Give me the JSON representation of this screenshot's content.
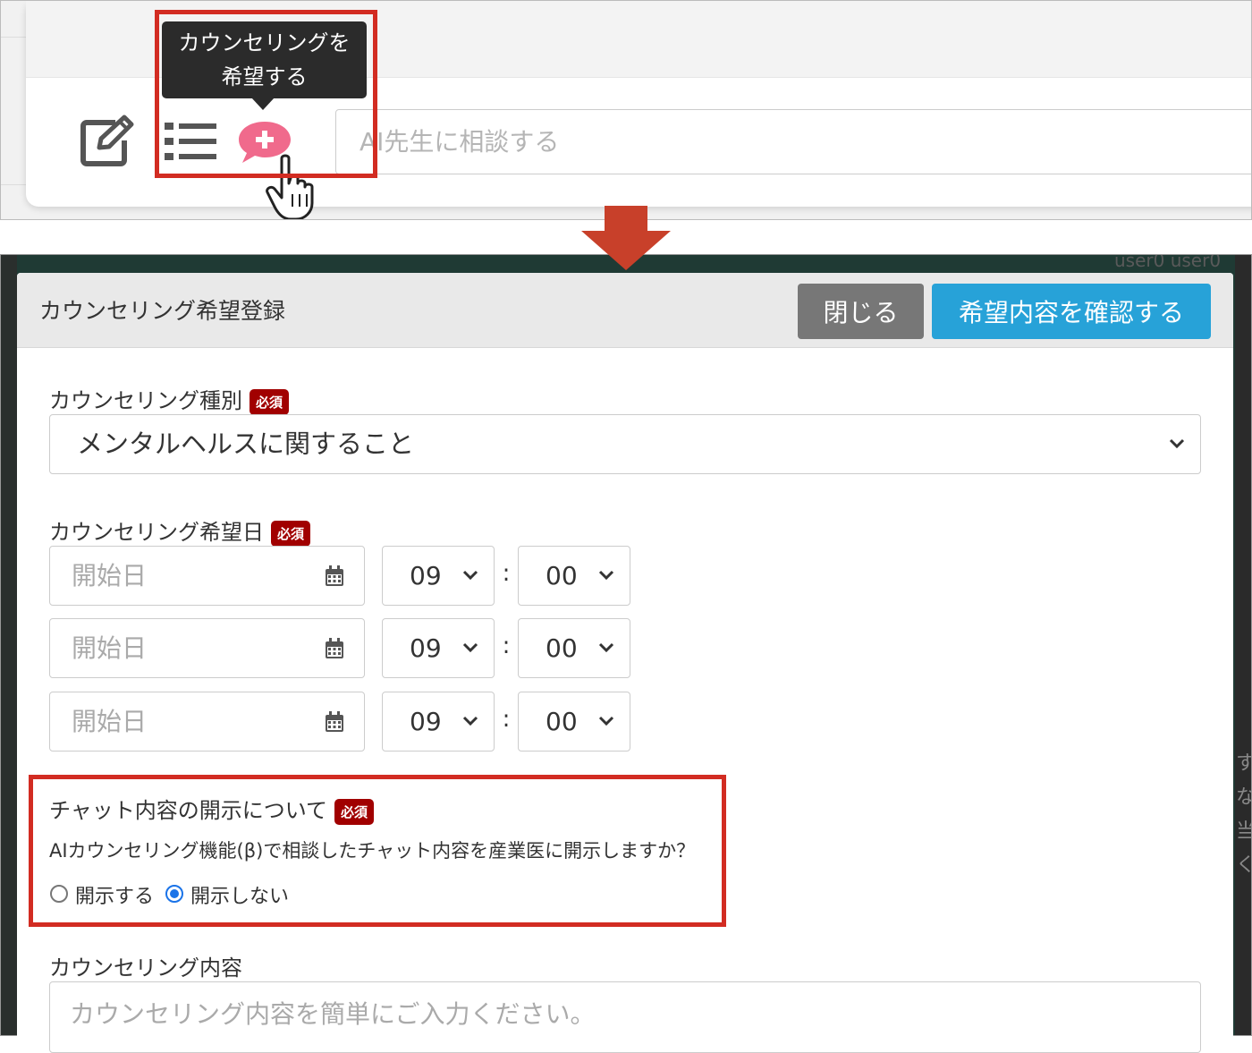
{
  "top": {
    "tooltip_line1": "カウンセリングを",
    "tooltip_line2": "希望する",
    "ai_input_placeholder": "AI先生に相談する",
    "icons": [
      "edit-icon",
      "list-icon",
      "chat-plus-icon",
      "hand-cursor-icon"
    ]
  },
  "bottom": {
    "background_user": "user0 user0",
    "background_side_chars": [
      "す",
      "な",
      "当",
      "く"
    ],
    "modal": {
      "title": "カウンセリング希望登録",
      "close_label": "閉じる",
      "confirm_label": "希望内容を確認する"
    },
    "required_badge": "必須",
    "counseling_type": {
      "label": "カウンセリング種別",
      "selected": "メンタルヘルスに関すること"
    },
    "preferred_date": {
      "label": "カウンセリング希望日",
      "rows": [
        {
          "date_placeholder": "開始日",
          "hour": "09",
          "minute": "00"
        },
        {
          "date_placeholder": "開始日",
          "hour": "09",
          "minute": "00"
        },
        {
          "date_placeholder": "開始日",
          "hour": "09",
          "minute": "00"
        }
      ],
      "separator": ":"
    },
    "disclosure": {
      "label": "チャット内容の開示について",
      "question": "AIカウンセリング機能(β)で相談したチャット内容を産業医に開示しますか？",
      "options": [
        {
          "label": "開示する",
          "checked": false
        },
        {
          "label": "開示しない",
          "checked": true
        }
      ]
    },
    "content": {
      "label": "カウンセリング内容",
      "placeholder": "カウンセリング内容を簡単にご入力ください。"
    }
  },
  "colors": {
    "highlight": "#d22c22",
    "arrow": "#c8402a",
    "primary_button": "#27a2d8",
    "close_button": "#777777",
    "required_badge": "#a10000",
    "chat_icon": "#f06a8c"
  }
}
